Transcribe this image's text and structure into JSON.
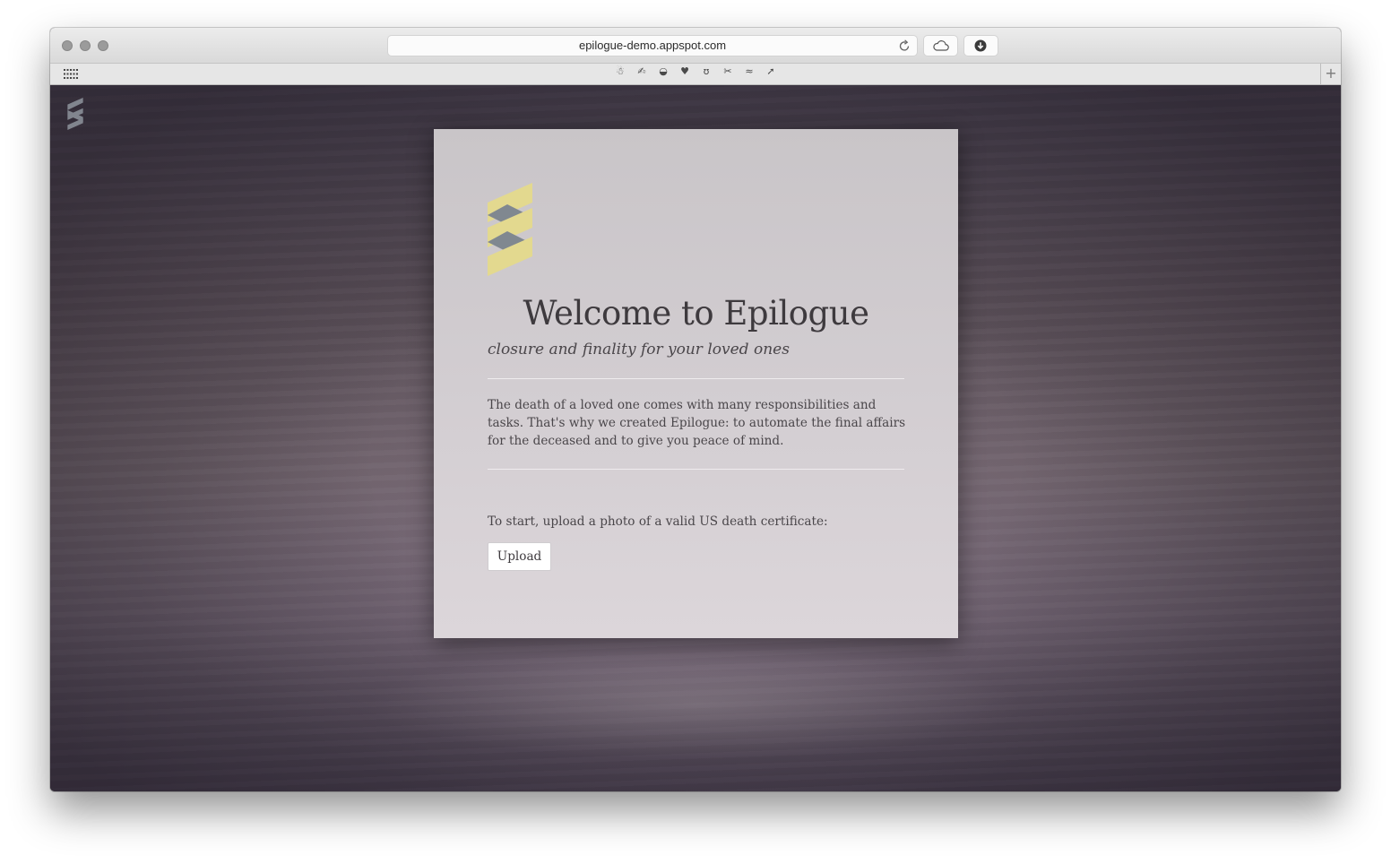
{
  "browser": {
    "url": "epilogue-demo.appspot.com",
    "icons": {
      "reload": "reload-icon",
      "cloud": "cloud-icon",
      "download": "download-icon",
      "apps_grid": "grid-icon",
      "new_tab": "+"
    },
    "bookmark_glyphs": [
      "☃",
      "✍",
      "◒",
      "♥",
      "ʊ",
      "✂",
      "≈",
      "➚"
    ]
  },
  "page": {
    "corner_logo": "epilogue-logo-icon",
    "title": "Welcome to Epilogue",
    "subtitle": "closure and finality for your loved ones",
    "description": "The death of a loved one comes with many responsibilities and tasks. That's why we created Epilogue: to automate the final affairs for the deceased and to give you peace of mind.",
    "start_prompt": "To start, upload a photo of a valid US death certificate:",
    "upload_label": "Upload"
  },
  "colors": {
    "logo_yellow": "#e3d98f",
    "logo_gray": "#808890",
    "card_background": "#d2cdd1",
    "text": "#4a464a"
  }
}
